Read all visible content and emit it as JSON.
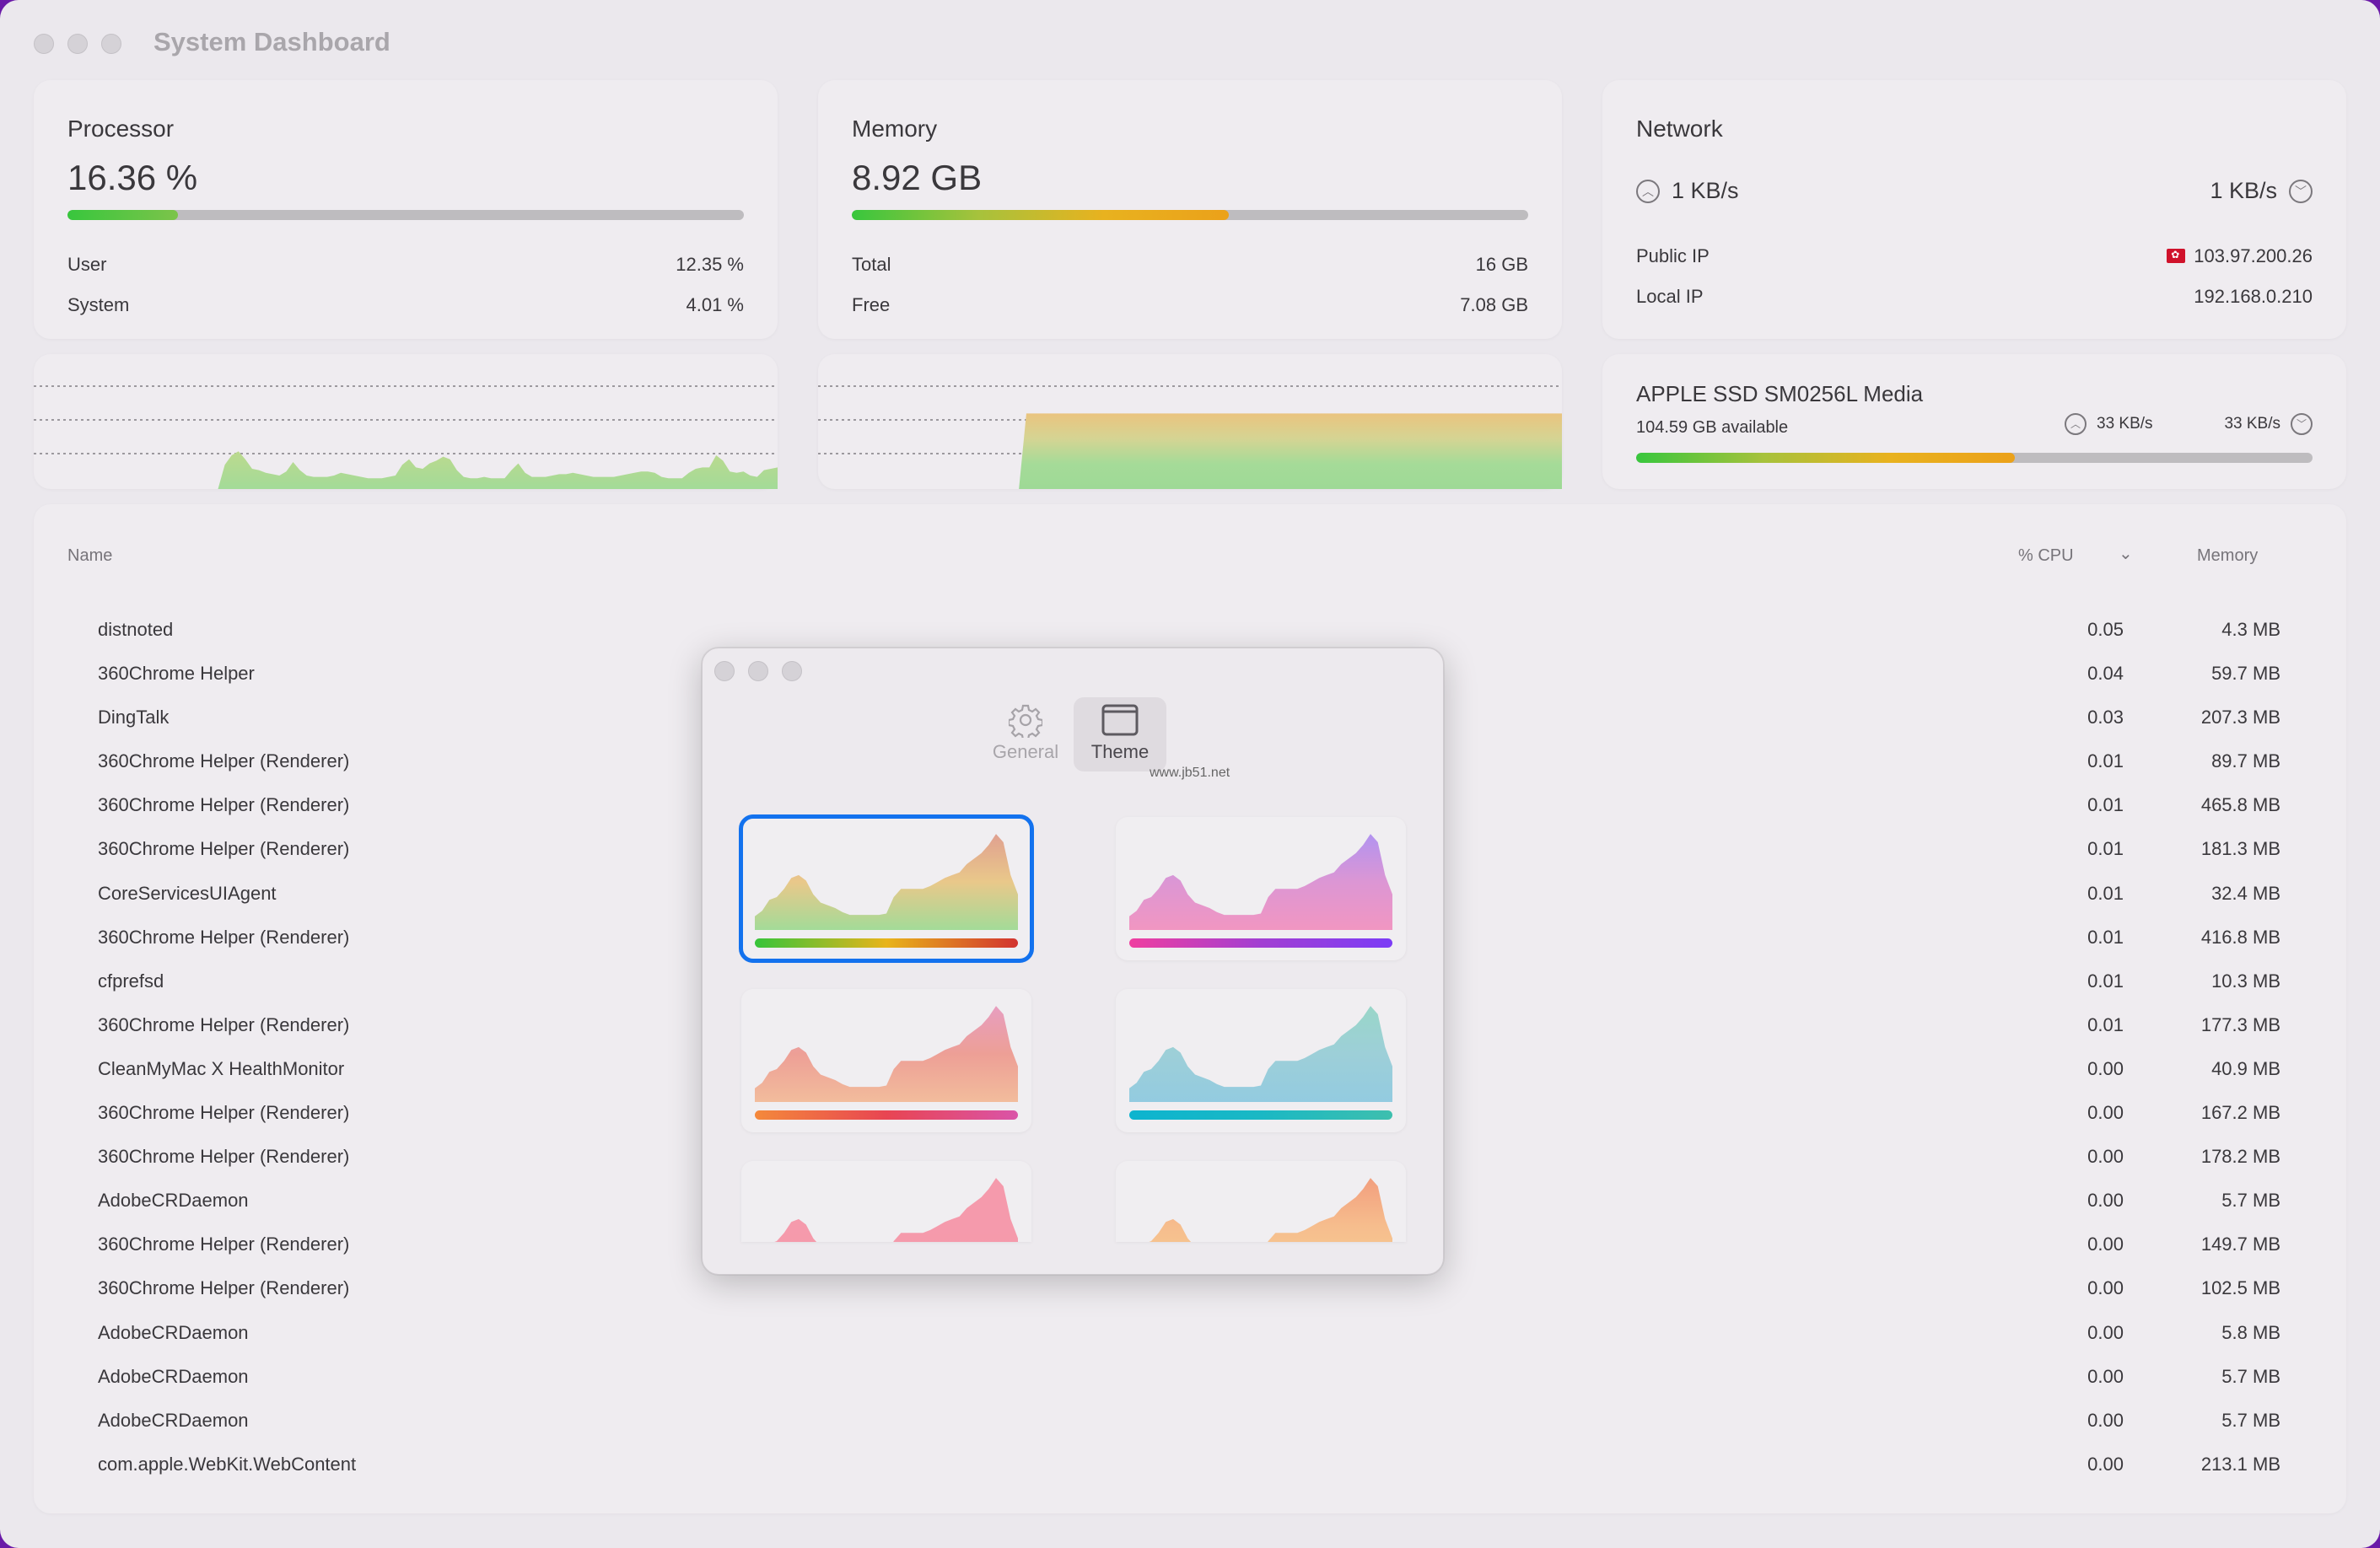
{
  "window": {
    "title": "System Dashboard"
  },
  "processor": {
    "title": "Processor",
    "value": "16.36 %",
    "usage_percent": 16.36,
    "rows": [
      {
        "label": "User",
        "value": "12.35 %"
      },
      {
        "label": "System",
        "value": "4.01 %"
      }
    ],
    "bar_gradient": [
      "#38c63d",
      "#7cc44a"
    ]
  },
  "memory": {
    "title": "Memory",
    "value": "8.92 GB",
    "usage_percent": 55.75,
    "rows": [
      {
        "label": "Total",
        "value": "16 GB"
      },
      {
        "label": "Free",
        "value": "7.08 GB"
      }
    ],
    "bar_gradient": [
      "#38c63d",
      "#a6c23c",
      "#e8b21f",
      "#eba11a"
    ]
  },
  "network": {
    "title": "Network",
    "upload": "1 KB/s",
    "download": "1 KB/s",
    "upload_icon": "arrow-up-circle-icon",
    "download_icon": "arrow-down-circle-icon",
    "rows": [
      {
        "label": "Public IP",
        "value": "103.97.200.26",
        "icon": "hong-kong-flag-icon"
      },
      {
        "label": "Local IP",
        "value": "192.168.0.210"
      }
    ]
  },
  "disk": {
    "title": "APPLE SSD SM0256L Media",
    "available": "104.59 GB available",
    "read": "33 KB/s",
    "write": "33 KB/s",
    "usage_percent": 56
  },
  "cpu_chart": {
    "type": "area",
    "gridlines": 3,
    "ylim": [
      0,
      100
    ],
    "note": "history starts ~27% into the time window",
    "values": [
      null,
      null,
      null,
      null,
      null,
      null,
      null,
      null,
      null,
      null,
      null,
      null,
      null,
      null,
      null,
      null,
      null,
      null,
      null,
      null,
      null,
      null,
      null,
      null,
      null,
      null,
      null,
      0,
      18,
      25,
      28,
      22,
      15,
      14,
      12,
      11,
      10,
      13,
      20,
      14,
      10,
      9,
      9,
      9,
      10,
      12,
      11,
      10,
      9,
      8,
      8,
      8,
      9,
      10,
      18,
      22,
      16,
      15,
      19,
      21,
      24,
      22,
      14,
      9,
      8,
      8,
      9,
      8,
      8,
      8,
      14,
      19,
      12,
      9,
      9,
      9,
      10,
      11,
      11,
      12,
      11,
      10,
      9,
      9,
      9,
      9,
      10,
      11,
      12,
      13,
      13,
      12,
      9,
      8,
      8,
      8,
      12,
      15,
      16,
      16,
      25,
      21,
      13,
      12,
      13,
      10,
      9,
      14,
      15,
      16
    ]
  },
  "memory_chart": {
    "type": "area",
    "gridlines": 3,
    "ylim": [
      0,
      100
    ],
    "values": [
      null,
      null,
      null,
      null,
      null,
      null,
      null,
      null,
      null,
      null,
      null,
      null,
      null,
      null,
      null,
      null,
      null,
      null,
      null,
      null,
      null,
      null,
      null,
      null,
      null,
      null,
      null,
      0,
      56,
      56,
      56,
      56,
      56,
      56,
      56,
      56,
      56,
      56,
      56,
      56,
      56,
      56,
      56,
      56,
      56,
      56,
      56,
      56,
      56,
      56,
      56,
      56,
      56,
      56,
      56,
      56,
      56,
      56,
      56,
      56,
      56,
      56,
      56,
      56,
      56,
      56,
      56,
      56,
      56,
      56,
      56,
      56,
      56,
      56,
      56,
      56,
      56,
      56,
      56,
      56,
      56,
      56,
      56,
      56,
      56,
      56,
      56,
      56,
      56,
      56,
      56,
      56,
      56,
      56,
      56,
      56,
      56,
      56,
      56,
      56,
      56
    ]
  },
  "table": {
    "columns": {
      "name": "Name",
      "cpu": "% CPU",
      "memory": "Memory"
    },
    "sort_icon": "chevron-down-icon",
    "rows": [
      {
        "name": "distnoted",
        "cpu": "0.05",
        "memory": "4.3 MB"
      },
      {
        "name": "360Chrome Helper",
        "cpu": "0.04",
        "memory": "59.7 MB"
      },
      {
        "name": "DingTalk",
        "cpu": "0.03",
        "memory": "207.3 MB"
      },
      {
        "name": "360Chrome Helper (Renderer)",
        "cpu": "0.01",
        "memory": "89.7 MB"
      },
      {
        "name": "360Chrome Helper (Renderer)",
        "cpu": "0.01",
        "memory": "465.8 MB"
      },
      {
        "name": "360Chrome Helper (Renderer)",
        "cpu": "0.01",
        "memory": "181.3 MB"
      },
      {
        "name": "CoreServicesUIAgent",
        "cpu": "0.01",
        "memory": "32.4 MB"
      },
      {
        "name": "360Chrome Helper (Renderer)",
        "cpu": "0.01",
        "memory": "416.8 MB"
      },
      {
        "name": "cfprefsd",
        "cpu": "0.01",
        "memory": "10.3 MB"
      },
      {
        "name": "360Chrome Helper (Renderer)",
        "cpu": "0.01",
        "memory": "177.3 MB"
      },
      {
        "name": "CleanMyMac X HealthMonitor",
        "cpu": "0.00",
        "memory": "40.9 MB"
      },
      {
        "name": "360Chrome Helper (Renderer)",
        "cpu": "0.00",
        "memory": "167.2 MB"
      },
      {
        "name": "360Chrome Helper (Renderer)",
        "cpu": "0.00",
        "memory": "178.2 MB"
      },
      {
        "name": "AdobeCRDaemon",
        "cpu": "0.00",
        "memory": "5.7 MB"
      },
      {
        "name": "360Chrome Helper (Renderer)",
        "cpu": "0.00",
        "memory": "149.7 MB"
      },
      {
        "name": "360Chrome Helper (Renderer)",
        "cpu": "0.00",
        "memory": "102.5 MB"
      },
      {
        "name": "AdobeCRDaemon",
        "cpu": "0.00",
        "memory": "5.8 MB"
      },
      {
        "name": "AdobeCRDaemon",
        "cpu": "0.00",
        "memory": "5.7 MB"
      },
      {
        "name": "AdobeCRDaemon",
        "cpu": "0.00",
        "memory": "5.7 MB"
      },
      {
        "name": "com.apple.WebKit.WebContent",
        "cpu": "0.00",
        "memory": "213.1 MB"
      }
    ]
  },
  "preferences": {
    "tabs": [
      {
        "label": "General",
        "icon": "gear-icon",
        "active": false
      },
      {
        "label": "Theme",
        "icon": "window-icon",
        "active": true
      }
    ],
    "watermark": "www.jb51.net",
    "preview_values": [
      10,
      14,
      22,
      24,
      30,
      38,
      40,
      36,
      26,
      20,
      18,
      16,
      13,
      11,
      11,
      11,
      11,
      11,
      12,
      24,
      30,
      30,
      30,
      30,
      32,
      35,
      38,
      40,
      42,
      48,
      52,
      56,
      62,
      70,
      64,
      40,
      26
    ],
    "themes": [
      {
        "name": "green-yellow-red",
        "selected": true,
        "area": [
          "#e0a090",
          "#e9c88a",
          "#a3db98"
        ],
        "bar": [
          "#36c43a",
          "#e8b41b",
          "#d2332f"
        ]
      },
      {
        "name": "pink-purple",
        "selected": false,
        "area": [
          "#b293f0",
          "#dc96d4",
          "#f196c1"
        ],
        "bar": [
          "#ef3fa0",
          "#a23fd2",
          "#7c3cf6"
        ]
      },
      {
        "name": "orange-pink",
        "selected": false,
        "area": [
          "#e79ec0",
          "#ed9f96",
          "#f2bc9c"
        ],
        "bar": [
          "#f4893b",
          "#e84552",
          "#da54a8"
        ]
      },
      {
        "name": "teal-blue",
        "selected": false,
        "area": [
          "#99d6c8",
          "#9dcfd8",
          "#93cbe0"
        ],
        "bar": [
          "#0db4cf",
          "#1ab8c4",
          "#3ebfae"
        ]
      },
      {
        "name": "pink",
        "selected": false,
        "area": [
          "#f59aac",
          "#f59aac",
          "#f49ca8"
        ],
        "bar": [
          "#f07890",
          "#f07890"
        ]
      },
      {
        "name": "peach",
        "selected": false,
        "area": [
          "#f29e7e",
          "#f6bd8d",
          "#f7cc93"
        ],
        "bar": [
          "#f6a070",
          "#f8c080"
        ]
      }
    ]
  }
}
